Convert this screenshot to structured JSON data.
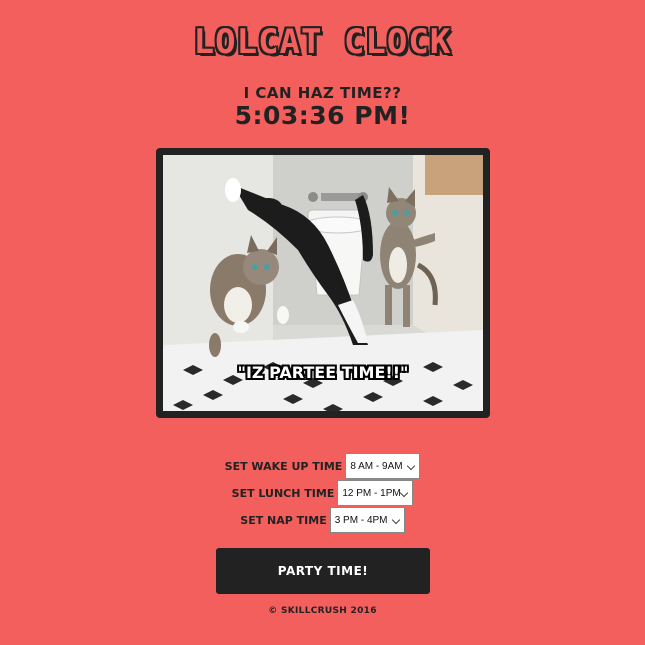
{
  "header": {
    "title": "Lolcat Clock",
    "subtitle": "I can haz time??",
    "time": "5:03:36 PM!"
  },
  "photo": {
    "caption": "\"IZ PARTEE TIME!!\""
  },
  "settings": [
    {
      "label": "Set Wake Up Time",
      "value": "8 AM - 9AM"
    },
    {
      "label": "Set Lunch Time",
      "value": "12 PM - 1PM"
    },
    {
      "label": "Set Nap Time",
      "value": "3 PM - 4PM"
    }
  ],
  "party_button": {
    "label": "Party Time!"
  },
  "footer": {
    "text": "© Skillcrush 2016"
  },
  "colors": {
    "background": "#f25f5c",
    "dark": "#222222",
    "white": "#ffffff"
  }
}
